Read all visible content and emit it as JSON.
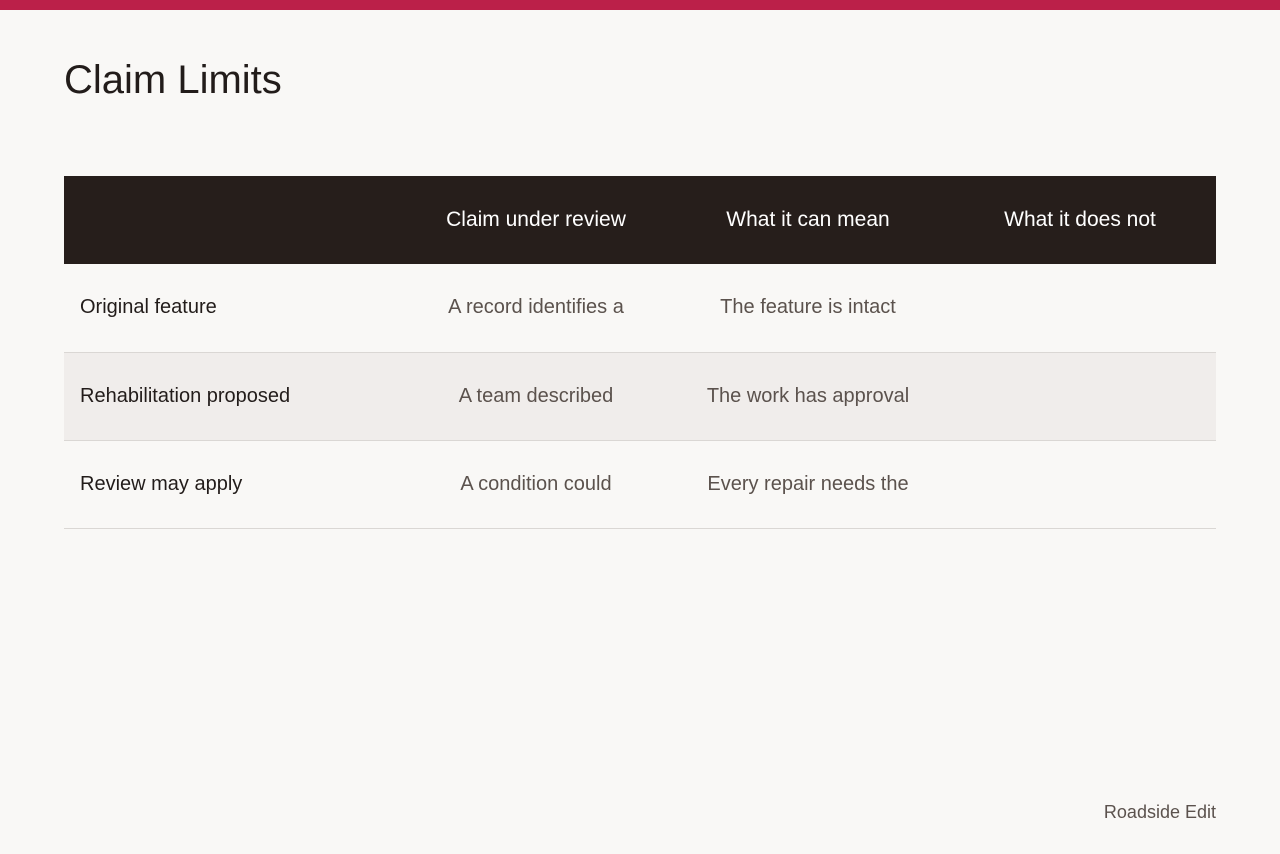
{
  "colors": {
    "accent": "#bb2049",
    "header_bg": "#261e1b",
    "page_bg": "#f9f8f6",
    "alt_row_bg": "#f0edeb"
  },
  "page": {
    "title": "Claim Limits"
  },
  "table": {
    "headers": [
      "",
      "Claim under review",
      "What it can mean",
      "What it does not"
    ],
    "rows": [
      {
        "label": "Original feature",
        "claim": "A record identifies a",
        "meaning": "The feature is intact",
        "not": ""
      },
      {
        "label": "Rehabilitation proposed",
        "claim": "A team described",
        "meaning": "The work has approval",
        "not": ""
      },
      {
        "label": "Review may apply",
        "claim": "A condition could",
        "meaning": "Every repair needs the",
        "not": ""
      }
    ]
  },
  "footer": {
    "brand": "Roadside Edit"
  }
}
